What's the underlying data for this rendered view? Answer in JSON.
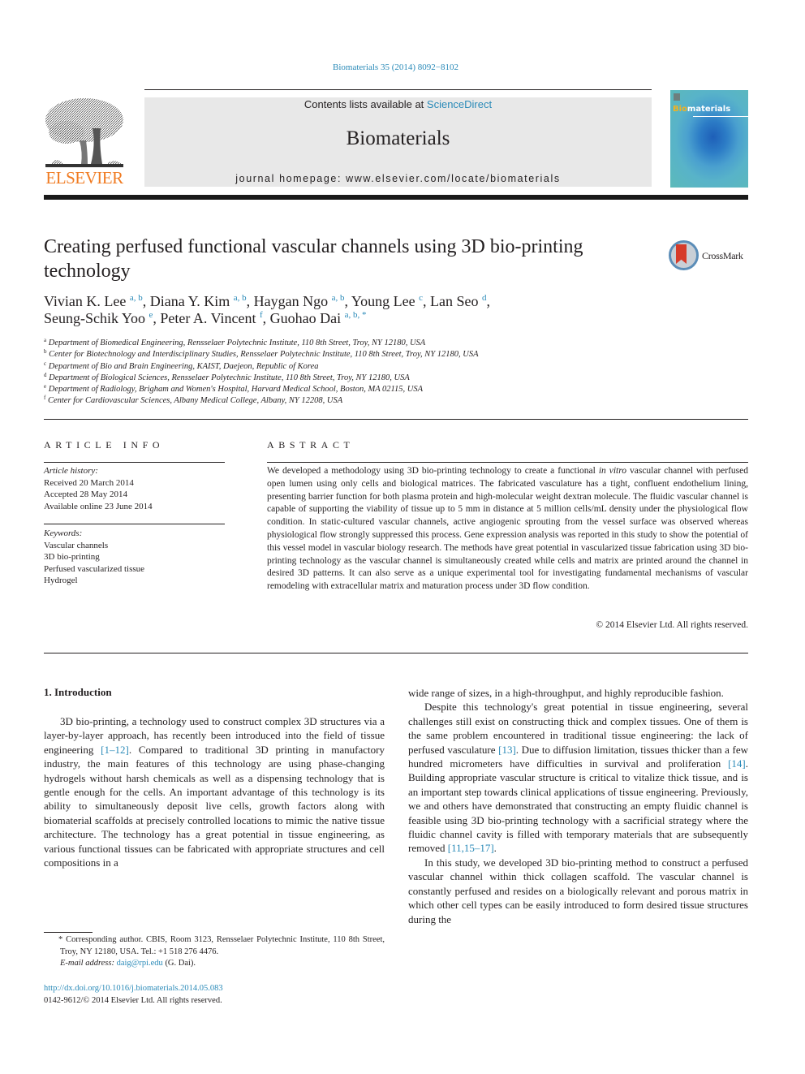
{
  "journal_ref": "Biomaterials 35 (2014) 8092−8102",
  "masthead": {
    "publisher": "ELSEVIER",
    "contents_prefix": "Contents lists available at ",
    "contents_link": "ScienceDirect",
    "journal_title": "Biomaterials",
    "homepage": "journal homepage: www.elsevier.com/locate/biomaterials",
    "cover": {
      "title_accent": "Bio",
      "title_rest": "materials",
      "colors": {
        "accent": "#f5b21c",
        "background": "#4aa0cf"
      }
    }
  },
  "article": {
    "title": "Creating perfused functional vascular channels using 3D bio-printing technology",
    "crossmark_label": "CrossMark",
    "authors": [
      {
        "name": "Vivian K. Lee",
        "affil": "a, b"
      },
      {
        "name": "Diana Y. Kim",
        "affil": "a, b"
      },
      {
        "name": "Haygan Ngo",
        "affil": "a, b"
      },
      {
        "name": "Young Lee",
        "affil": "c"
      },
      {
        "name": "Lan Seo",
        "affil": "d"
      },
      {
        "name": "Seung-Schik Yoo",
        "affil": "e"
      },
      {
        "name": "Peter A. Vincent",
        "affil": "f"
      },
      {
        "name": "Guohao Dai",
        "affil": "a, b, *"
      }
    ],
    "affiliations": [
      {
        "key": "a",
        "text": "Department of Biomedical Engineering, Rensselaer Polytechnic Institute, 110 8th Street, Troy, NY 12180, USA"
      },
      {
        "key": "b",
        "text": "Center for Biotechnology and Interdisciplinary Studies, Rensselaer Polytechnic Institute, 110 8th Street, Troy, NY 12180, USA"
      },
      {
        "key": "c",
        "text": "Department of Bio and Brain Engineering, KAIST, Daejeon, Republic of Korea"
      },
      {
        "key": "d",
        "text": "Department of Biological Sciences, Rensselaer Polytechnic Institute, 110 8th Street, Troy, NY 12180, USA"
      },
      {
        "key": "e",
        "text": "Department of Radiology, Brigham and Women's Hospital, Harvard Medical School, Boston, MA 02115, USA"
      },
      {
        "key": "f",
        "text": "Center for Cardiovascular Sciences, Albany Medical College, Albany, NY 12208, USA"
      }
    ]
  },
  "article_info": {
    "heading": "ARTICLE INFO",
    "history_label": "Article history:",
    "history": [
      "Received 20 March 2014",
      "Accepted 28 May 2014",
      "Available online 23 June 2014"
    ],
    "keywords_label": "Keywords:",
    "keywords": [
      "Vascular channels",
      "3D bio-printing",
      "Perfused vascularized tissue",
      "Hydrogel"
    ]
  },
  "abstract": {
    "heading": "ABSTRACT",
    "part1": "We developed a methodology using 3D bio-printing technology to create a functional ",
    "italic": "in vitro",
    "part2": " vascular channel with perfused open lumen using only cells and biological matrices. The fabricated vasculature has a tight, confluent endothelium lining, presenting barrier function for both plasma protein and high-molecular weight dextran molecule. The fluidic vascular channel is capable of supporting the viability of tissue up to 5 mm in distance at 5 million cells/mL density under the physiological flow condition. In static-cultured vascular channels, active angiogenic sprouting from the vessel surface was observed whereas physiological flow strongly suppressed this process. Gene expression analysis was reported in this study to show the potential of this vessel model in vascular biology research. The methods have great potential in vascularized tissue fabrication using 3D bio-printing technology as the vascular channel is simultaneously created while cells and matrix are printed around the channel in desired 3D patterns. It can also serve as a unique experimental tool for investigating fundamental mechanisms of vascular remodeling with extracellular matrix and maturation process under 3D flow condition.",
    "copyright": "© 2014 Elsevier Ltd. All rights reserved."
  },
  "body": {
    "section_heading": "1.  Introduction",
    "p1": {
      "a": "3D bio-printing, a technology used to construct complex 3D structures via a layer-by-layer approach, has recently been introduced into the field of tissue engineering ",
      "ref1": "[1‒12]",
      "b": ". Compared to traditional 3D printing in manufactory industry, the main features of this technology are using phase-changing hydrogels without harsh chemicals as well as a dispensing technology that is gentle enough for the cells. An important advantage of this technology is its ability to simultaneously deposit live cells, growth factors along with biomaterial scaffolds at precisely controlled locations to mimic the native tissue architecture. The technology has a great potential in tissue engineering, as various functional tissues can be fabricated with appropriate structures and cell compositions in a ",
      "c": "wide range of sizes, in a high-throughput, and highly reproducible fashion."
    },
    "p2": {
      "a": "Despite this technology's great potential in tissue engineering, several challenges still exist on constructing thick and complex tissues. One of them is the same problem encountered in traditional tissue engineering: the lack of perfused vasculature ",
      "ref1": "[13]",
      "b": ". Due to diffusion limitation, tissues thicker than a few hundred micrometers have difficulties in survival and proliferation ",
      "ref2": "[14]",
      "c": ". Building appropriate vascular structure is critical to vitalize thick tissue, and is an important step towards clinical applications of tissue engineering. Previously, we and others have demonstrated that constructing an empty fluidic channel is feasible using 3D bio-printing technology with a sacrificial strategy where the fluidic channel cavity is filled with temporary materials that are subsequently removed ",
      "ref3": "[11,15‒17]",
      "d": "."
    },
    "p3": "In this study, we developed 3D bio-printing method to construct a perfused vascular channel within thick collagen scaffold. The vascular channel is constantly perfused and resides on a biologically relevant and porous matrix in which other cell types can be easily introduced to form desired tissue structures during the"
  },
  "footnote": {
    "corresponding": "* Corresponding author. CBIS, Room 3123, Rensselaer Polytechnic Institute, 110 8th Street, Troy, NY 12180, USA. Tel.: +1 518 276 4476.",
    "email_label": "E-mail address: ",
    "email": "daig@rpi.edu",
    "email_suffix": " (G. Dai).",
    "doi": "http://dx.doi.org/10.1016/j.biomaterials.2014.05.083",
    "issn": "0142-9612/© 2014 Elsevier Ltd. All rights reserved."
  },
  "colors": {
    "link": "#2a8ab8",
    "elsevier_orange": "#f07b22",
    "banner_bg": "#e8e8e8",
    "text": "#231f20"
  }
}
